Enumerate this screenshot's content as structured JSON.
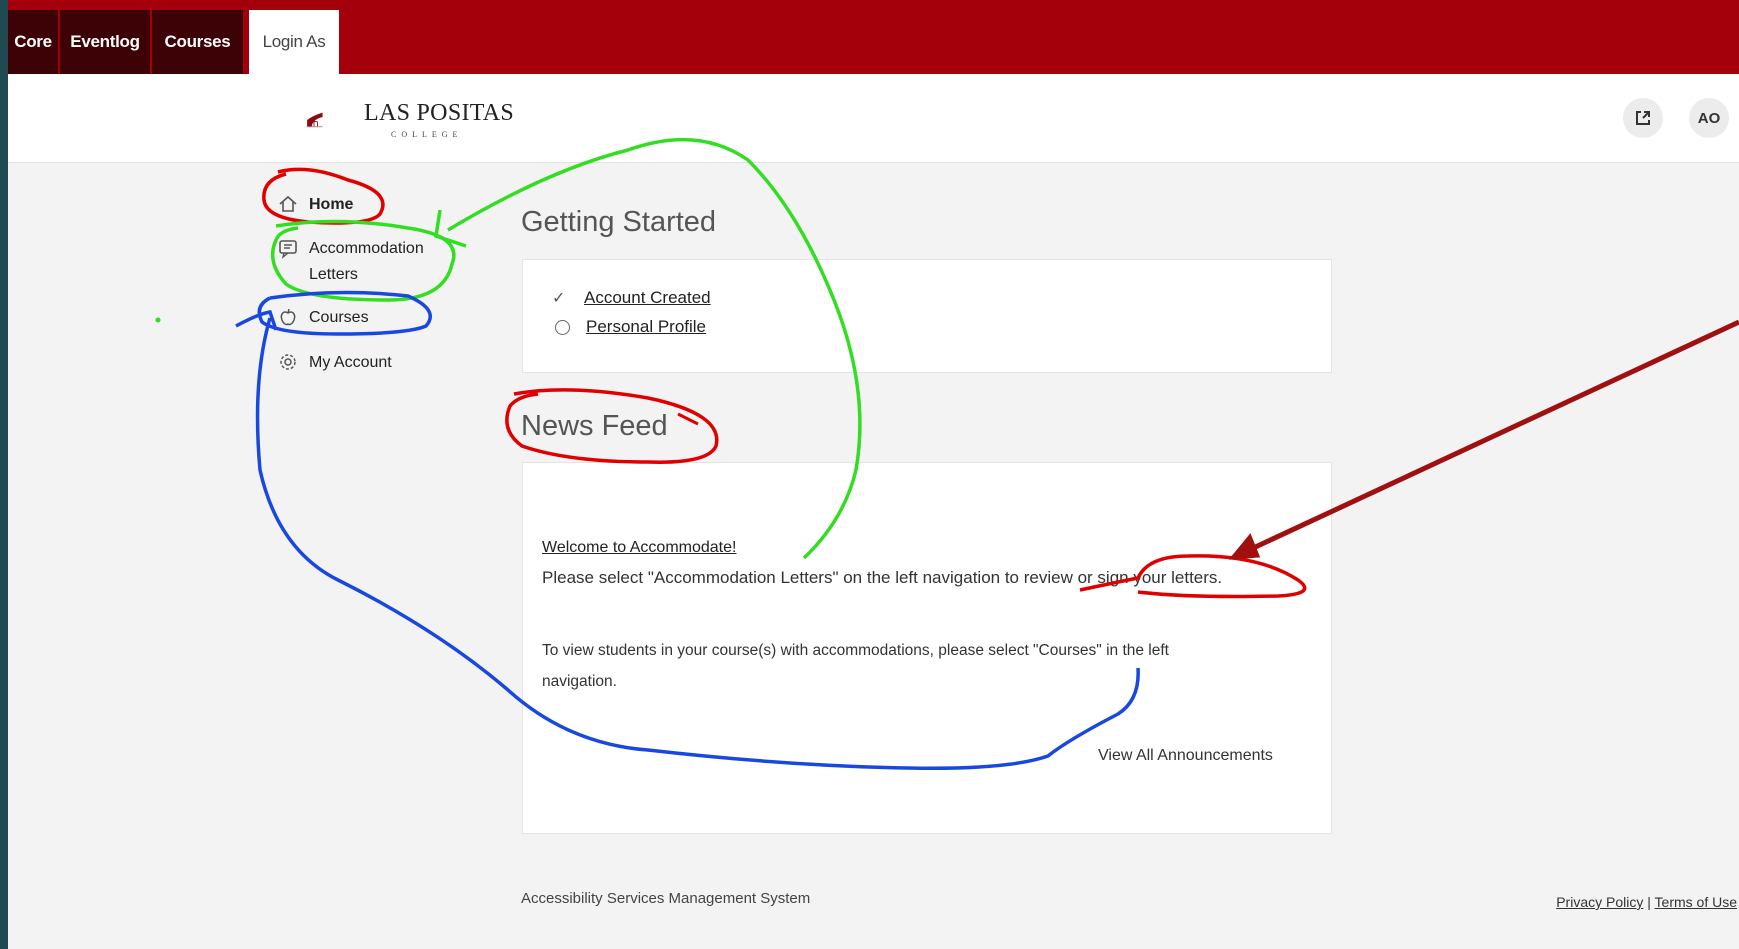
{
  "tabs": [
    {
      "label": "Core",
      "active": false
    },
    {
      "label": "Eventlog",
      "active": false
    },
    {
      "label": "Courses",
      "active": false
    },
    {
      "label": "Login As",
      "active": true
    }
  ],
  "header": {
    "logo_title": "LAS POSITAS",
    "logo_subtitle": "COLLEGE",
    "external_icon": "external-link-icon",
    "avatar_initials": "AO"
  },
  "sidebar": {
    "items": [
      {
        "label": "Home",
        "icon": "home-icon",
        "bold": true
      },
      {
        "label": "Accommodation Letters",
        "icon": "letter-icon",
        "bold": false
      },
      {
        "label": "Courses",
        "icon": "apple-icon",
        "bold": false
      },
      {
        "label": "My Account",
        "icon": "gear-icon",
        "bold": false
      }
    ]
  },
  "getting_started": {
    "title": "Getting Started",
    "items": [
      {
        "label": "Account Created",
        "status": "done"
      },
      {
        "label": "Personal Profile",
        "status": "pending"
      }
    ]
  },
  "news_feed": {
    "title": "News Feed",
    "link": "Welcome to Accommodate!",
    "line1": "Please select \"Accommodation Letters\" on the left navigation to review or sign your letters.",
    "line2a": "To view students in your course(s) with accommodations, please select \"Courses\" in the left",
    "line2b": "navigation.",
    "view_all": "View All Announcements"
  },
  "footer": {
    "system_name": "Accessibility Services Management System",
    "privacy": "Privacy Policy",
    "separator": "|",
    "terms": "Terms of Use"
  },
  "colors": {
    "brand_red": "#a3000c",
    "tab_dark": "#3d0205",
    "annotation_red": "#e00000",
    "annotation_green": "#33dd22",
    "annotation_blue": "#1848e0",
    "arrow_darkred": "#a01010"
  }
}
